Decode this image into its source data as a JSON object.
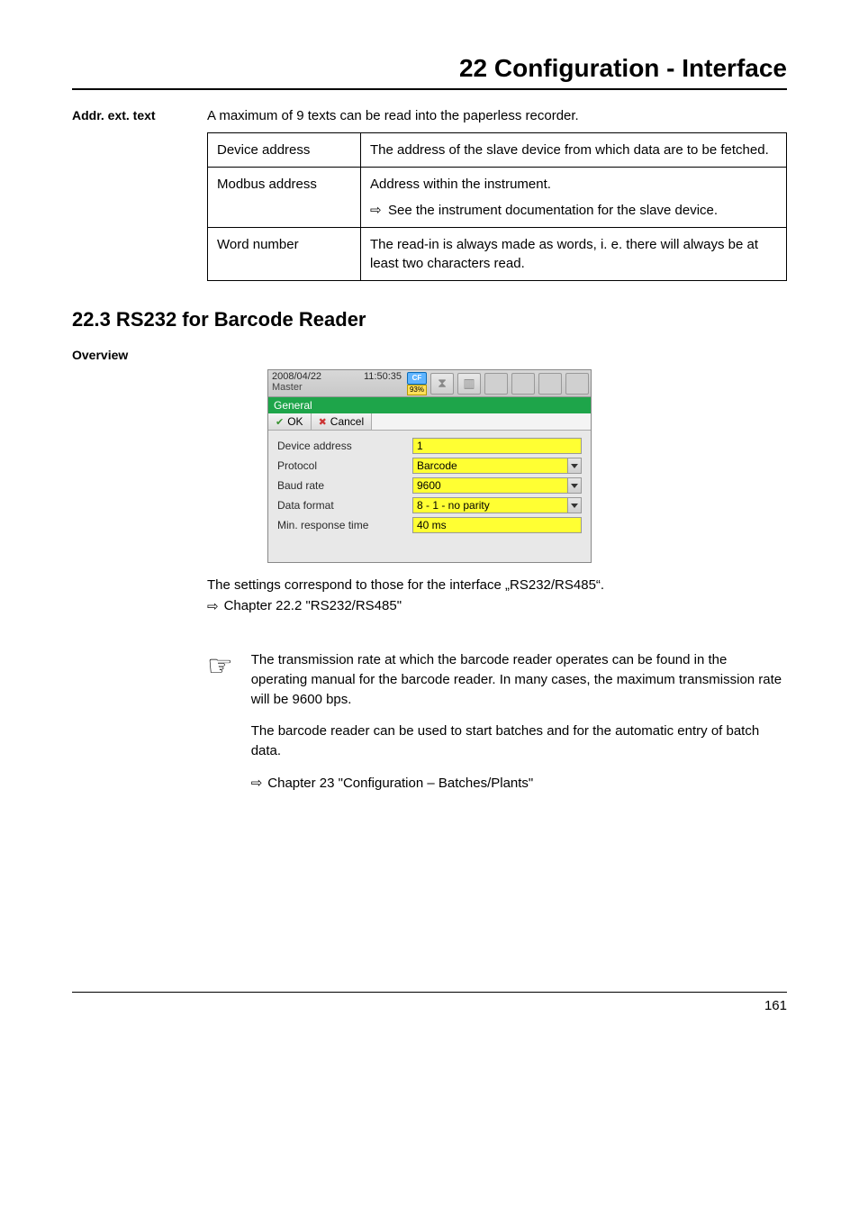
{
  "chapter_title": "22 Configuration - Interface",
  "side": {
    "addr_ext": "Addr. ext. text",
    "overview": "Overview"
  },
  "intro_text": "A maximum of 9 texts can be read into the paperless recorder.",
  "table": {
    "r1c1": "Device address",
    "r1c2": "The address of the slave device from which data are to be fetched.",
    "r2c1": "Modbus address",
    "r2c2a": "Address within the instrument.",
    "r2c2b": "See the instrument documentation for the slave device.",
    "r3c1": "Word number",
    "r3c2": "The read-in is always made as words, i. e. there will always be at least two characters read."
  },
  "section_heading": "22.3   RS232 for Barcode Reader",
  "device": {
    "date": "2008/04/22",
    "time": "11:50:35",
    "mode": "Master",
    "cf": "CF",
    "pct": "93%",
    "general": "General",
    "ok": "OK",
    "cancel": "Cancel",
    "rows": {
      "devaddr_lbl": "Device address",
      "devaddr_val": "1",
      "protocol_lbl": "Protocol",
      "protocol_val": "Barcode",
      "baud_lbl": "Baud rate",
      "baud_val": "9600",
      "dataformat_lbl": "Data format",
      "dataformat_val": "8 - 1 - no parity",
      "minresp_lbl": "Min. response time",
      "minresp_val": "40 ms"
    }
  },
  "after_device_text": "The settings correspond to those for the interface „RS232/RS485“.",
  "after_device_ref": "Chapter 22.2 \"RS232/RS485\"",
  "tip": {
    "p1": "The transmission rate at which the barcode reader operates can be found in the operating manual for the barcode reader. In many cases, the maximum transmission rate will be 9600 bps.",
    "p2": "The barcode reader can be used to start batches and for the automatic entry of batch data.",
    "ref": "Chapter 23 \"Configuration – Batches/Plants\""
  },
  "arrow": "⇨",
  "hand_glyph": "☞",
  "page_number": "161"
}
